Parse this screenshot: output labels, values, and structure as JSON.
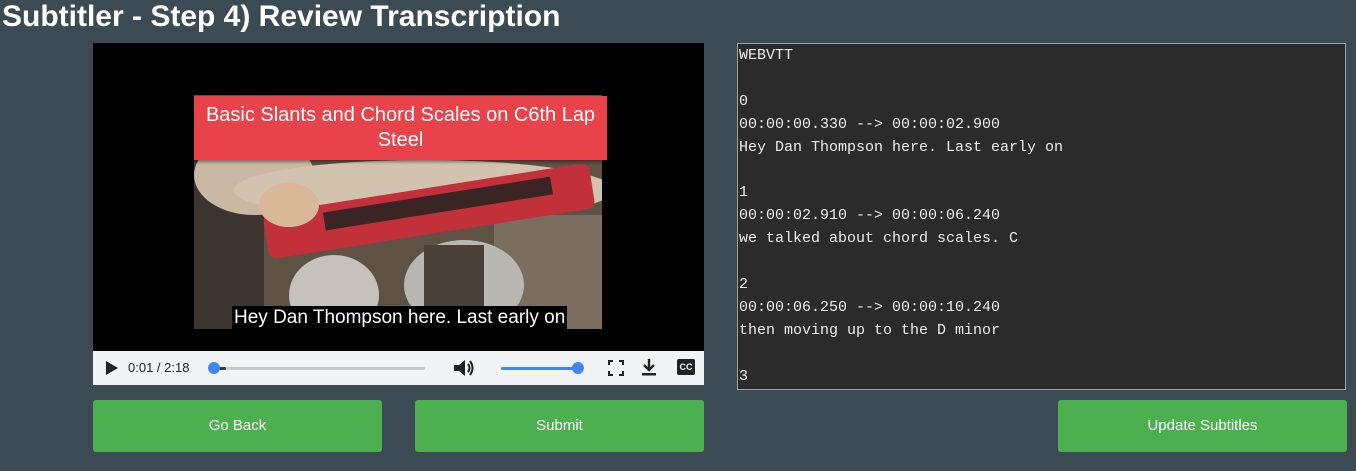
{
  "page": {
    "title": "Subtitler - Step 4) Review Transcription",
    "background_color": "#3c4a54"
  },
  "video": {
    "banner_text": "Basic Slants and Chord Scales on C6th Lap Steel",
    "caption_text": "Hey Dan Thompson here. Last early on",
    "controls": {
      "time_display": "0:01 / 2:18",
      "progress_fraction": 0.007,
      "volume_fraction": 1.0,
      "cc_label": "CC",
      "icons": [
        "play-icon",
        "volume-icon",
        "fullscreen-icon",
        "download-icon",
        "closed-captions-icon"
      ]
    }
  },
  "transcript": {
    "text": "WEBVTT\n\n0\n00:00:00.330 --> 00:00:02.900\nHey Dan Thompson here. Last early on\n\n1\n00:00:02.910 --> 00:00:06.240\nwe talked about chord scales. C\n\n2\n00:00:06.250 --> 00:00:10.240\nthen moving up to the D minor\n\n3"
  },
  "buttons": {
    "go_back": "Go Back",
    "submit": "Submit",
    "update_subtitles": "Update Subtitles",
    "color": "#4caf50"
  }
}
